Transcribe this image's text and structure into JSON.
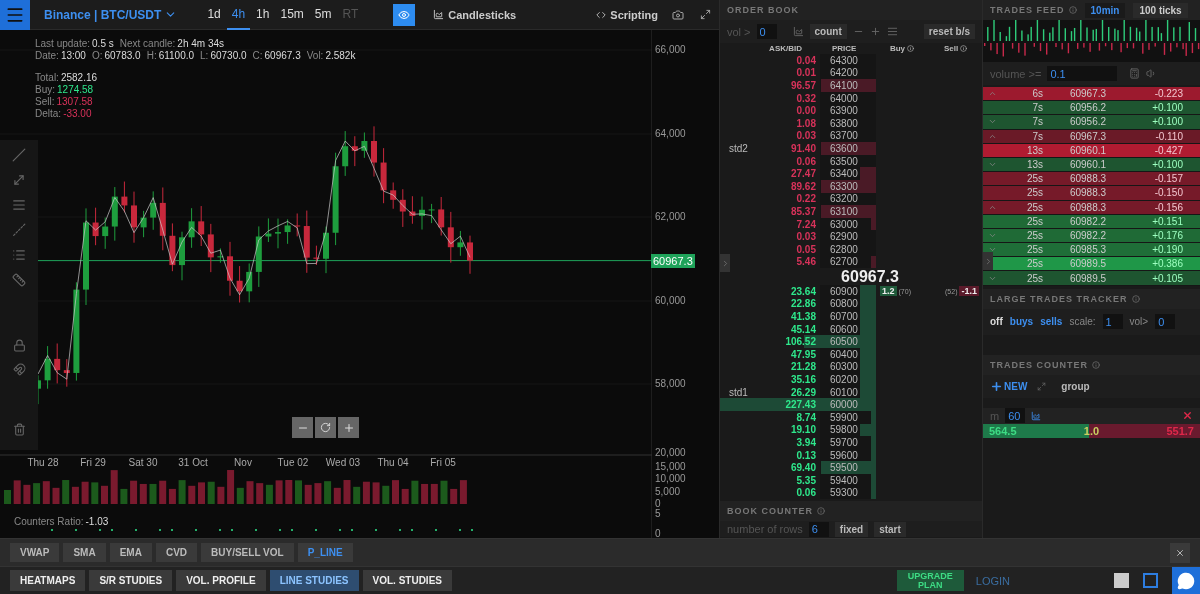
{
  "chart_panel": {
    "market": "Binance | BTC/USDT",
    "timeframes": [
      {
        "label": "1d",
        "selected": false,
        "disabled": false
      },
      {
        "label": "4h",
        "selected": true,
        "disabled": false
      },
      {
        "label": "1h",
        "selected": false,
        "disabled": false
      },
      {
        "label": "15m",
        "selected": false,
        "disabled": false
      },
      {
        "label": "5m",
        "selected": false,
        "disabled": false
      },
      {
        "label": "RT",
        "selected": false,
        "disabled": true
      }
    ],
    "visibility_on": true,
    "chart_type": "Candlesticks",
    "scripting": "Scripting",
    "info_lines": [
      [
        {
          "label": "Last update:",
          "value": "0.5 s"
        },
        {
          "label": "Next candle:",
          "value": "2h 4m 34s"
        }
      ],
      [
        {
          "label": "Date:",
          "value": "13:00"
        },
        {
          "label": "O:",
          "value": "60783.0"
        },
        {
          "label": "H:",
          "value": "61100.0"
        },
        {
          "label": "L:",
          "value": "60730.0"
        },
        {
          "label": "C:",
          "value": "60967.3"
        },
        {
          "label": "Vol:",
          "value": "2.582k"
        }
      ]
    ],
    "totals": [
      {
        "label": "Total:",
        "value": "2582.16",
        "kind": "neutral"
      },
      {
        "label": "Buy:",
        "value": "1274.58",
        "kind": "buy"
      },
      {
        "label": "Sell:",
        "value": "1307.58",
        "kind": "sell"
      },
      {
        "label": "Delta:",
        "value": "-33.00",
        "kind": "sell"
      }
    ],
    "price_axis": [
      "66,000",
      "64,000",
      "62,000",
      "60,000",
      "58,000"
    ],
    "last_price": "60967.3",
    "time_axis": [
      "Thu 28",
      "Fri 29",
      "Sat 30",
      "31 Oct",
      "Nov",
      "Tue 02",
      "Wed 03",
      "Thu 04",
      "Fri 05"
    ],
    "volume_axis": [
      "20,000",
      "15,000",
      "10,000",
      "5,000",
      "0",
      "5",
      "0"
    ],
    "counters_ratio": {
      "label": "Counters Ratio:",
      "value": "-1.03"
    }
  },
  "order_book": {
    "title": "ORDER BOOK",
    "vol_label": "vol >",
    "vol_value": "0",
    "count": "count",
    "reset": "reset b/s",
    "columns": [
      "ASK/BID",
      "PRICE",
      "Buy",
      "Sell"
    ],
    "asks": [
      {
        "amount": "0.04",
        "price": "64300",
        "kind": "none"
      },
      {
        "amount": "0.01",
        "price": "64200",
        "kind": "none"
      },
      {
        "amount": "96.57",
        "price": "64100",
        "kind": "medium"
      },
      {
        "amount": "0.32",
        "price": "64000",
        "kind": "none"
      },
      {
        "amount": "0.00",
        "price": "63900",
        "kind": "none"
      },
      {
        "amount": "1.08",
        "price": "63800",
        "kind": "none"
      },
      {
        "amount": "0.03",
        "price": "63700",
        "kind": "none"
      },
      {
        "amount": "91.40",
        "price": "63600",
        "kind": "medium",
        "marker": "std2"
      },
      {
        "amount": "0.06",
        "price": "63500",
        "kind": "none"
      },
      {
        "amount": "27.47",
        "price": "63400",
        "kind": "small"
      },
      {
        "amount": "89.62",
        "price": "63300",
        "kind": "medium"
      },
      {
        "amount": "0.22",
        "price": "63200",
        "kind": "none"
      },
      {
        "amount": "85.37",
        "price": "63100",
        "kind": "medium"
      },
      {
        "amount": "7.24",
        "price": "63000",
        "kind": "tiny"
      },
      {
        "amount": "0.03",
        "price": "62900",
        "kind": "none"
      },
      {
        "amount": "0.05",
        "price": "62800",
        "kind": "none"
      },
      {
        "amount": "5.46",
        "price": "62700",
        "kind": "tiny"
      }
    ],
    "mid_price": "60967.3",
    "bids": [
      {
        "amount": "23.64",
        "price": "60900",
        "kind": "small",
        "buy": "1.2",
        "buy_count": "(70)",
        "sell_count": "(52)",
        "sell": "-1.1"
      },
      {
        "amount": "22.86",
        "price": "60800",
        "kind": "small"
      },
      {
        "amount": "41.38",
        "price": "60700",
        "kind": "small"
      },
      {
        "amount": "45.14",
        "price": "60600",
        "kind": "small"
      },
      {
        "amount": "106.52",
        "price": "60500",
        "kind": "large"
      },
      {
        "amount": "47.95",
        "price": "60400",
        "kind": "small"
      },
      {
        "amount": "21.28",
        "price": "60300",
        "kind": "small"
      },
      {
        "amount": "35.16",
        "price": "60200",
        "kind": "small"
      },
      {
        "amount": "26.29",
        "price": "60100",
        "kind": "small",
        "marker": "std1"
      },
      {
        "amount": "227.43",
        "price": "60000",
        "kind": "full"
      },
      {
        "amount": "8.74",
        "price": "59900",
        "kind": "tiny"
      },
      {
        "amount": "19.10",
        "price": "59800",
        "kind": "small"
      },
      {
        "amount": "3.94",
        "price": "59700",
        "kind": "tiny"
      },
      {
        "amount": "0.13",
        "price": "59600",
        "kind": "tiny"
      },
      {
        "amount": "69.40",
        "price": "59500",
        "kind": "medium"
      },
      {
        "amount": "5.35",
        "price": "59400",
        "kind": "tiny"
      },
      {
        "amount": "0.06",
        "price": "59300",
        "kind": "tiny"
      }
    ],
    "book_counter": {
      "title": "BOOK COUNTER",
      "rows_label": "number of rows",
      "rows_value": "6",
      "fixed": "fixed",
      "start": "start"
    }
  },
  "trades_feed": {
    "title": "TRADES FEED",
    "tabs": [
      {
        "label": "10min",
        "selected": true
      },
      {
        "label": "100 ticks",
        "selected": false
      }
    ],
    "volume_label": "volume >=",
    "volume_value": "0.1",
    "rows": [
      {
        "kind": "up",
        "age": "6s",
        "price": "60967.3",
        "size": "-0.223",
        "buy": false,
        "color": "#9c1a2e"
      },
      {
        "kind": "none",
        "age": "7s",
        "price": "60956.2",
        "size": "+0.100",
        "buy": true,
        "color": "#1e5530"
      },
      {
        "kind": "down",
        "age": "7s",
        "price": "60956.2",
        "size": "+0.100",
        "buy": true,
        "color": "#1e5530"
      },
      {
        "kind": "up",
        "age": "7s",
        "price": "60967.3",
        "size": "-0.110",
        "buy": false,
        "color": "#6a1a27"
      },
      {
        "kind": "none",
        "age": "13s",
        "price": "60960.1",
        "size": "-0.427",
        "buy": false,
        "color": "#b01b31"
      },
      {
        "kind": "down",
        "age": "13s",
        "price": "60960.1",
        "size": "+0.100",
        "buy": true,
        "color": "#1e5530"
      },
      {
        "kind": "none",
        "age": "25s",
        "price": "60988.3",
        "size": "-0.157",
        "buy": false,
        "color": "#761a29"
      },
      {
        "kind": "none",
        "age": "25s",
        "price": "60988.3",
        "size": "-0.150",
        "buy": false,
        "color": "#761a29"
      },
      {
        "kind": "up",
        "age": "25s",
        "price": "60988.3",
        "size": "-0.156",
        "buy": false,
        "color": "#761a29"
      },
      {
        "kind": "none",
        "age": "25s",
        "price": "60982.2",
        "size": "+0.151",
        "buy": true,
        "color": "#1f6a36"
      },
      {
        "kind": "down",
        "age": "25s",
        "price": "60982.2",
        "size": "+0.176",
        "buy": true,
        "color": "#1f6a36"
      },
      {
        "kind": "down",
        "age": "25s",
        "price": "60985.3",
        "size": "+0.190",
        "buy": true,
        "color": "#1f6e38"
      },
      {
        "kind": "none",
        "age": "25s",
        "price": "60989.5",
        "size": "+0.386",
        "buy": true,
        "color": "#1f9748"
      },
      {
        "kind": "down",
        "age": "25s",
        "price": "60989.5",
        "size": "+0.105",
        "buy": true,
        "color": "#1e5530"
      }
    ]
  },
  "large_trades": {
    "title": "LARGE TRADES TRACKER",
    "options": [
      {
        "label": "off",
        "selected": false
      },
      {
        "label": "buys",
        "selected": true
      },
      {
        "label": "sells",
        "selected": true
      }
    ],
    "scale_label": "scale:",
    "scale_value": "1",
    "vol_label": "vol>",
    "vol_value": "0"
  },
  "trades_counter": {
    "title": "TRADES COUNTER",
    "new": "NEW",
    "group": "group",
    "counter": {
      "period_label": "m",
      "period_value": "60",
      "buy": "564.5",
      "ratio": "1.0",
      "sell": "551.7",
      "level": 0.49
    }
  },
  "indicators": [
    {
      "label": "VWAP",
      "selected": false
    },
    {
      "label": "SMA",
      "selected": false
    },
    {
      "label": "EMA",
      "selected": false
    },
    {
      "label": "CVD",
      "selected": false
    },
    {
      "label": "BUY/SELL VOL",
      "selected": false
    },
    {
      "label": "P_LINE",
      "selected": true
    }
  ],
  "studies": [
    {
      "label": "HEATMAPS",
      "selected": false
    },
    {
      "label": "S/R STUDIES",
      "selected": false
    },
    {
      "label": "VOL. PROFILE",
      "selected": false
    },
    {
      "label": "LINE STUDIES",
      "selected": true
    },
    {
      "label": "VOL. STUDIES",
      "selected": false
    }
  ],
  "upgrade": "UPGRADE PLAN",
  "login": "LOGIN"
}
